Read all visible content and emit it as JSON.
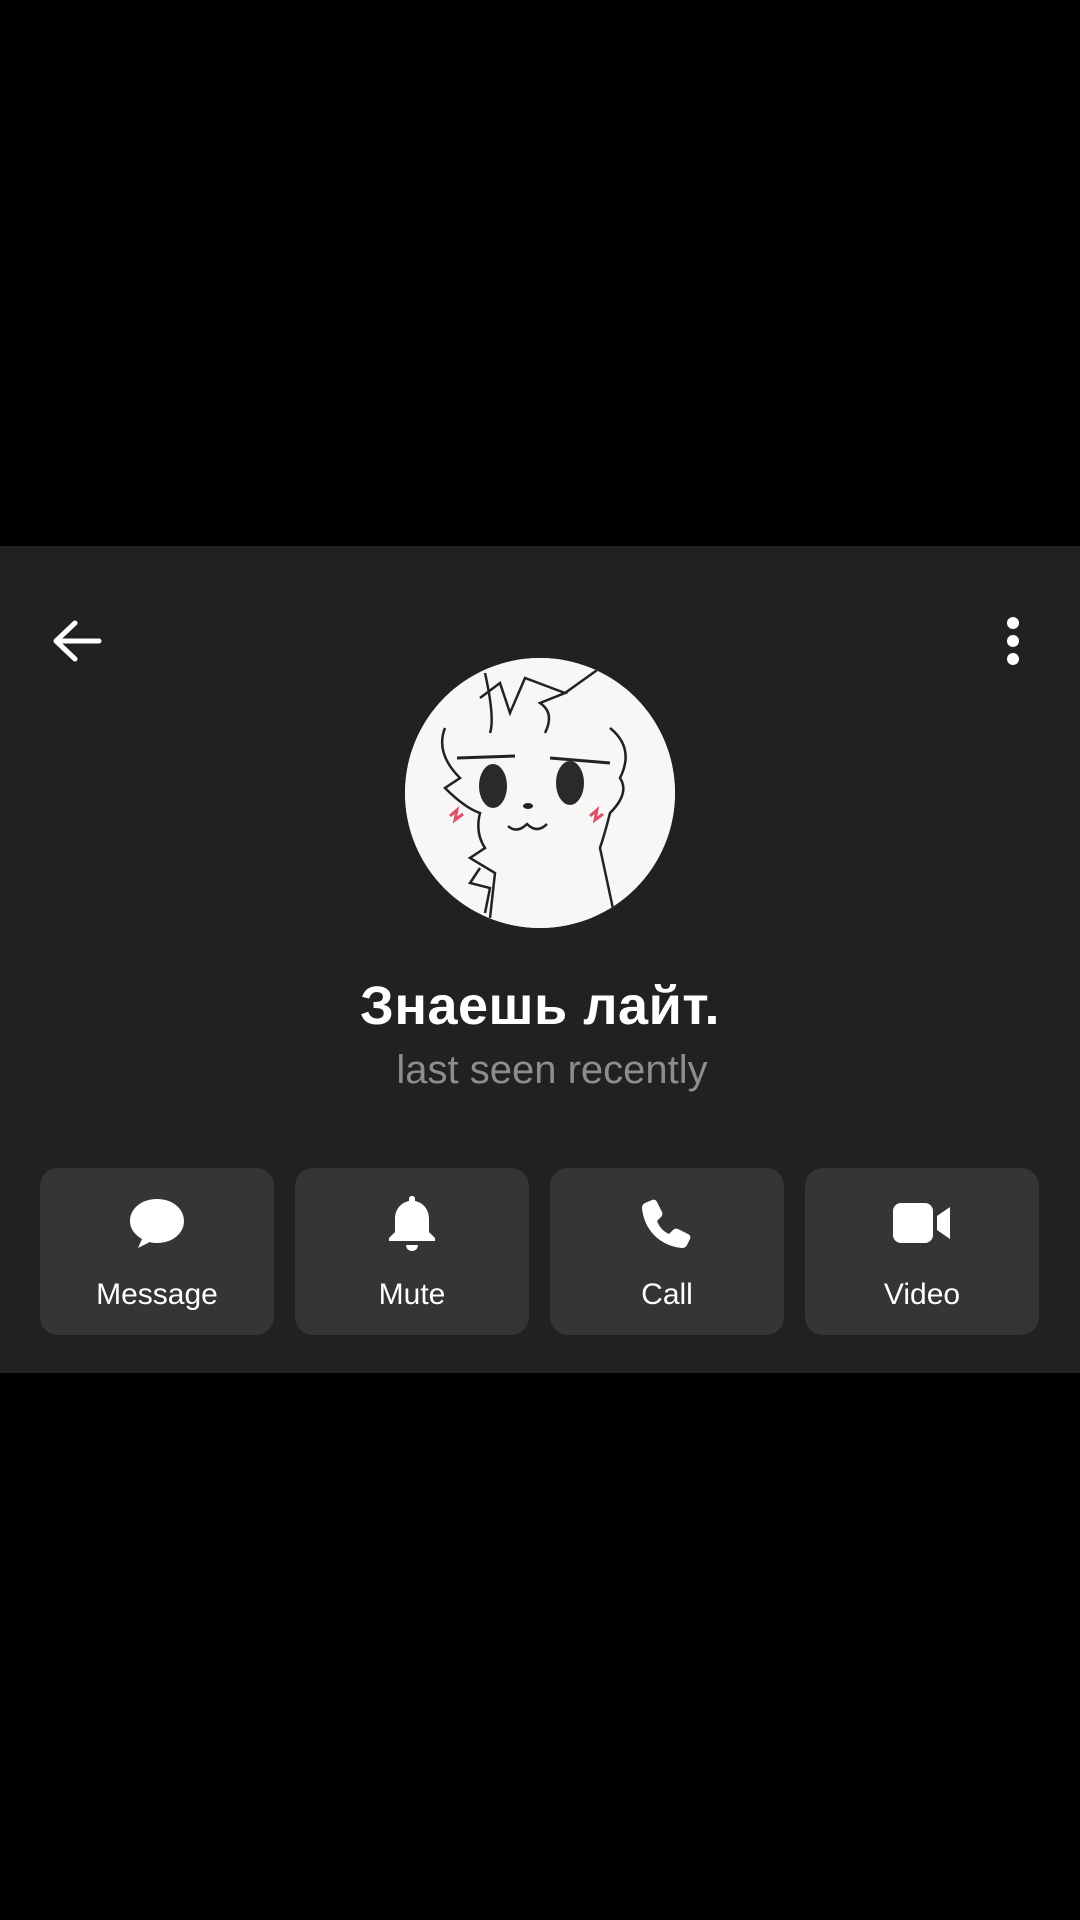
{
  "colors": {
    "background": "#000000",
    "panel": "#212121",
    "button": "#353436",
    "text_primary": "#ffffff",
    "text_secondary": "#8d8d8d"
  },
  "header": {
    "back_icon": "arrow-left-icon",
    "menu_icon": "more-vertical-icon"
  },
  "profile": {
    "avatar": "cartoon-cat-avatar",
    "name": "Знаешь лайт.",
    "status": "last seen recently"
  },
  "actions": [
    {
      "label": "Message",
      "icon": "message-bubble-icon"
    },
    {
      "label": "Mute",
      "icon": "bell-icon"
    },
    {
      "label": "Call",
      "icon": "phone-icon"
    },
    {
      "label": "Video",
      "icon": "video-camera-icon"
    }
  ]
}
